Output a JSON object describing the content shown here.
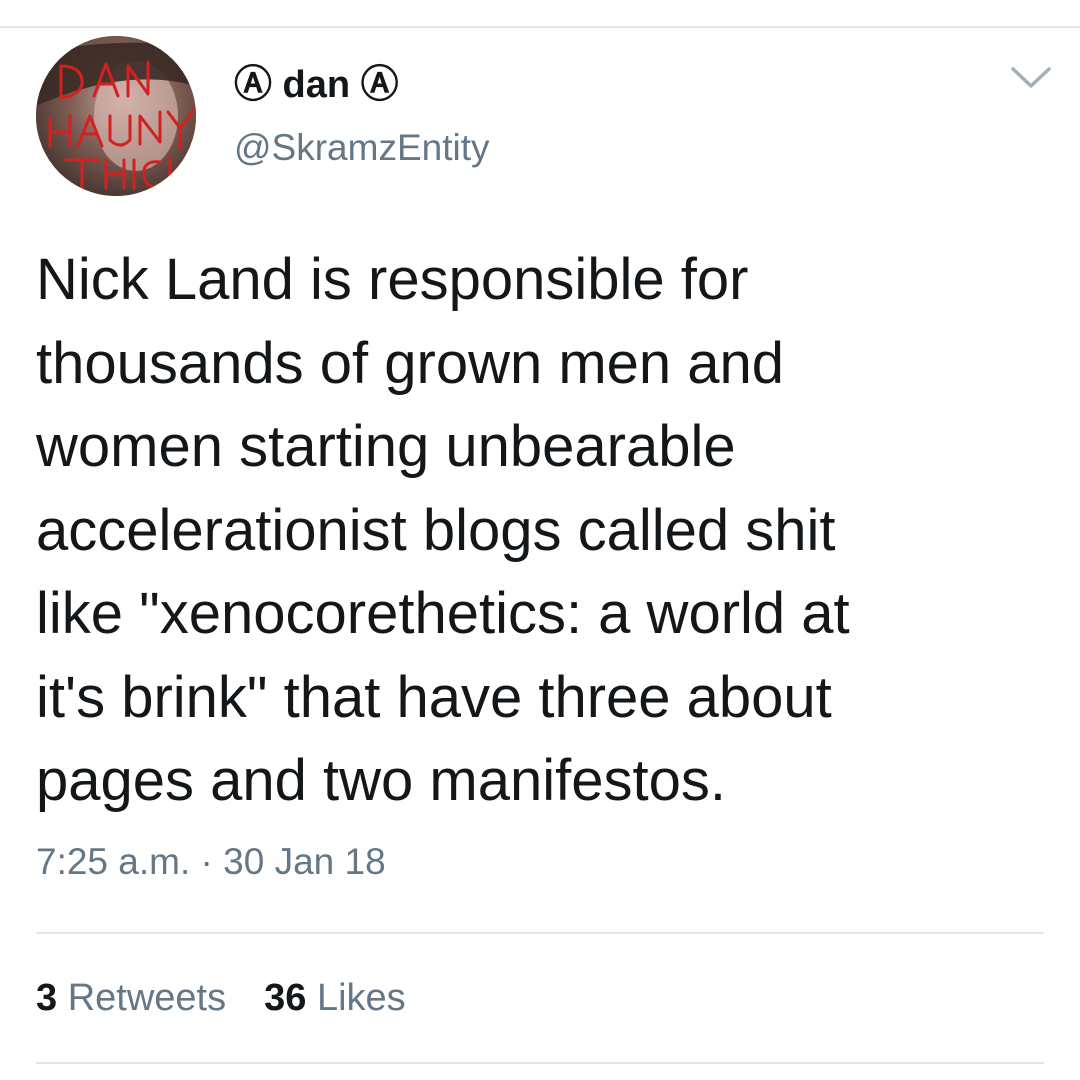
{
  "user": {
    "display_name": "Ⓐ dan Ⓐ",
    "handle": "@SkramzEntity",
    "avatar_icon": "profile-photo-with-red-scrawl",
    "avatar_scrawl_text": "DAN HAUN THICK"
  },
  "tweet": {
    "text": "Nick Land is responsible for\nthousands of grown men and\nwomen starting unbearable\naccelerationist blogs called shit\nlike \"xenocorethetics: a world at\nit's brink\" that have three about\npages and two manifestos.",
    "timestamp": "7:25 a.m. · 30 Jan 18"
  },
  "stats": {
    "retweets_count": "3",
    "retweets_label": "Retweets",
    "likes_count": "36",
    "likes_label": "Likes"
  },
  "menu": {
    "icon": "chevron-down-icon"
  },
  "colors": {
    "text_primary": "#14171a",
    "text_secondary": "#657786",
    "divider": "#e1e8ed",
    "scrawl_red": "#d42020"
  }
}
